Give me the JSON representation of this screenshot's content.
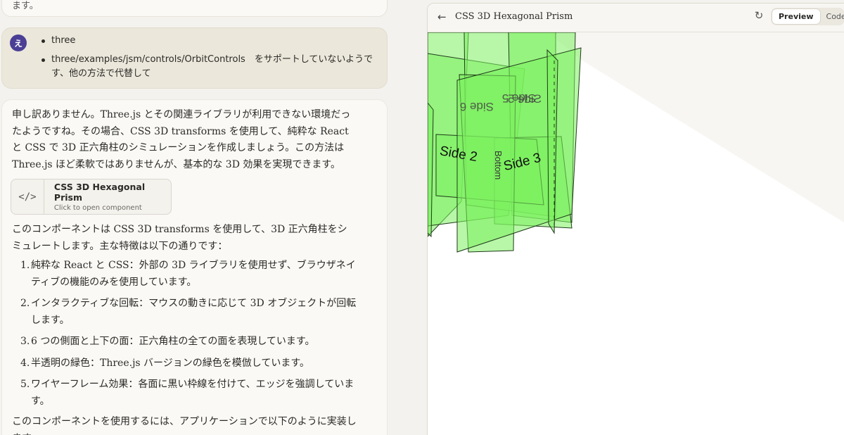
{
  "chat": {
    "prev_text": "ます。",
    "user": {
      "avatar": "え",
      "items": [
        "three",
        "three/examples/jsm/controls/OrbitControls　をサポートしていないようです、他の方法で代替して"
      ]
    },
    "assistant": {
      "intro": "申し訳ありません。Three.js とその関連ライブラリが利用できない環境だったようですね。その場合、CSS 3D transforms を使用して、純粋な React と CSS で 3D 正六角柱のシミュレーションを作成しましょう。この方法は Three.js ほど柔軟ではありませんが、基本的な 3D 効果を実現できます。",
      "artifact": {
        "icon": "code-icon",
        "icon_glyph": "</>",
        "title": "CSS 3D Hexagonal Prism",
        "subtitle": "Click to open component"
      },
      "desc": "このコンポーネントは CSS 3D transforms を使用して、3D 正六角柱をシミュレートします。主な特徴は以下の通りです：",
      "features": [
        {
          "num": "1.",
          "text": "純粋な React と CSS：外部の 3D ライブラリを使用せず、ブラウザネイティブの機能のみを使用しています。"
        },
        {
          "num": "2.",
          "text": "インタラクティブな回転：マウスの動きに応じて 3D オブジェクトが回転します。"
        },
        {
          "num": "3.",
          "text": "6 つの側面と上下の面：正六角柱の全ての面を表現しています。"
        },
        {
          "num": "4.",
          "text": "半透明の緑色：Three.js バージョンの緑色を模倣しています。"
        },
        {
          "num": "5.",
          "text": "ワイヤーフレーム効果：各面に黒い枠線を付けて、エッジを強調しています。"
        }
      ],
      "outro": "このコンポーネントを使用するには、アプリケーションで以下のように実装します。"
    }
  },
  "panel": {
    "back_icon": "arrow-left-icon",
    "title": "CSS 3D Hexagonal Prism",
    "refresh_icon": "refresh-icon",
    "tabs": [
      "Preview",
      "Code"
    ],
    "active_tab": "Preview",
    "faces": {
      "side2": "Side 2",
      "side3": "Side 3",
      "side5": "Side 5",
      "side6": "Side 6",
      "bottom": "Bottom"
    },
    "colors": {
      "face_fill": "#7cf05e",
      "face_stroke": "#1f3a1a"
    }
  }
}
